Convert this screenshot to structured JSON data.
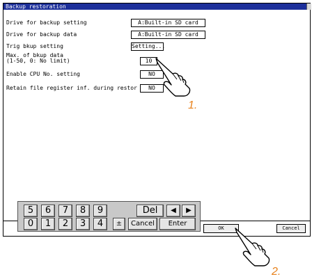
{
  "window": {
    "title": "Backup restoration"
  },
  "settings": {
    "drive_setting_label": "Drive for backup setting",
    "drive_setting_value": "A:Built-in SD card",
    "drive_data_label": "Drive for backup data",
    "drive_data_value": "A:Built-in SD card",
    "trig_label": "Trig bkup setting",
    "trig_button": "Setting...",
    "max_label_1": "Max. of bkup data",
    "max_label_2": "(1-50, 0: No limit)",
    "max_value": "10",
    "cpu_label": "Enable CPU No. setting",
    "cpu_value": "NO",
    "retain_label": "Retain file register inf. during restor",
    "retain_value": "NO"
  },
  "keypad": {
    "row1": [
      "5",
      "6",
      "7",
      "8",
      "9"
    ],
    "row2": [
      "0",
      "1",
      "2",
      "3",
      "4"
    ],
    "del": "Del",
    "left": "◀",
    "right": "▶",
    "sign": "±",
    "cancel": "Cancel",
    "enter": "Enter"
  },
  "footer": {
    "ok": "OK",
    "cancel": "Cancel"
  },
  "callouts": {
    "step1": "1.",
    "step2": "2."
  },
  "colors": {
    "titlebar": "#1c2f9a",
    "callout": "#e8811b"
  }
}
